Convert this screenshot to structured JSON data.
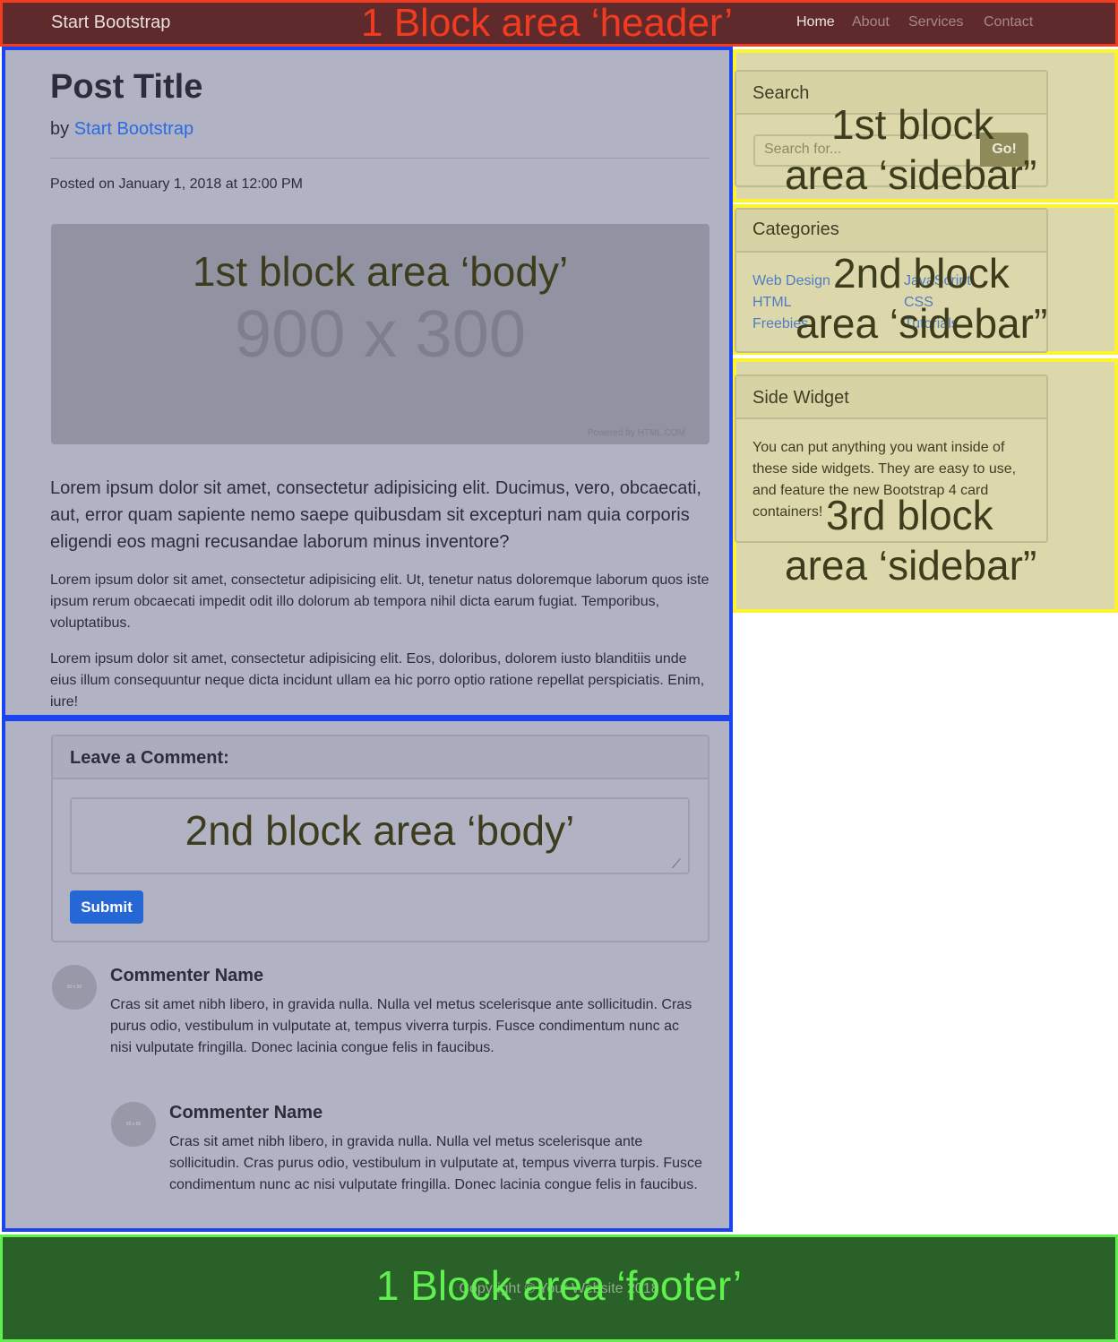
{
  "overlays": {
    "header": "1 Block area ‘header’",
    "body1": "1st block area ‘body’",
    "body2": "2nd block area ‘body’",
    "sidebar1_a": "1st block",
    "sidebar1_b": "area ‘sidebar”",
    "sidebar2_a": "2nd block",
    "sidebar2_b": "area ‘sidebar”",
    "sidebar3_a": "3rd block",
    "sidebar3_b": "area ‘sidebar”",
    "footer": "1 Block area ‘footer’"
  },
  "navbar": {
    "brand": "Start Bootstrap",
    "links": [
      "Home",
      "About",
      "Services",
      "Contact"
    ],
    "active": "Home"
  },
  "post": {
    "title": "Post Title",
    "by": "by",
    "author": "Start Bootstrap",
    "posted": "Posted on January 1, 2018 at 12:00 PM",
    "image_dims": "900 x 300",
    "image_credit": "Powered by HTML.COM",
    "lead": "Lorem ipsum dolor sit amet, consectetur adipisicing elit. Ducimus, vero, obcaecati, aut, error quam sapiente nemo saepe quibusdam sit excepturi nam quia corporis eligendi eos magni recusandae laborum minus inventore?",
    "paragraphs": [
      "Lorem ipsum dolor sit amet, consectetur adipisicing elit. Ut, tenetur natus doloremque laborum quos iste ipsum rerum obcaecati impedit odit illo dolorum ab tempora nihil dicta earum fugiat. Temporibus, voluptatibus.",
      "Lorem ipsum dolor sit amet, consectetur adipisicing elit. Eos, doloribus, dolorem iusto blanditiis unde eius illum consequuntur neque dicta incidunt ullam ea hic porro optio ratione repellat perspiciatis. Enim, iure!"
    ]
  },
  "comment_form": {
    "title": "Leave a Comment:",
    "submit": "Submit"
  },
  "comments": [
    {
      "avatar": "50 x 50",
      "name": "Commenter Name",
      "text": "Cras sit amet nibh libero, in gravida nulla. Nulla vel metus scelerisque ante sollicitudin. Cras purus odio, vestibulum in vulputate at, tempus viverra turpis. Fusce condimentum nunc ac nisi vulputate fringilla. Donec lacinia congue felis in faucibus."
    },
    {
      "avatar": "50 x 50",
      "name": "Commenter Name",
      "text": "Cras sit amet nibh libero, in gravida nulla. Nulla vel metus scelerisque ante sollicitudin. Cras purus odio, vestibulum in vulputate at, tempus viverra turpis. Fusce condimentum nunc ac nisi vulputate fringilla. Donec lacinia congue felis in faucibus."
    }
  ],
  "sidebar": {
    "search": {
      "title": "Search",
      "placeholder": "Search for...",
      "button": "Go!"
    },
    "categories": {
      "title": "Categories",
      "left": [
        "Web Design",
        "HTML",
        "Freebies"
      ],
      "right": [
        "JavaScript",
        "CSS",
        "Tutorials"
      ]
    },
    "widget": {
      "title": "Side Widget",
      "text": "You can put anything you want inside of these side widgets. They are easy to use, and feature the new Bootstrap 4 card containers!"
    }
  },
  "footer": {
    "copyright": "Copyright © Your Website 2018"
  }
}
